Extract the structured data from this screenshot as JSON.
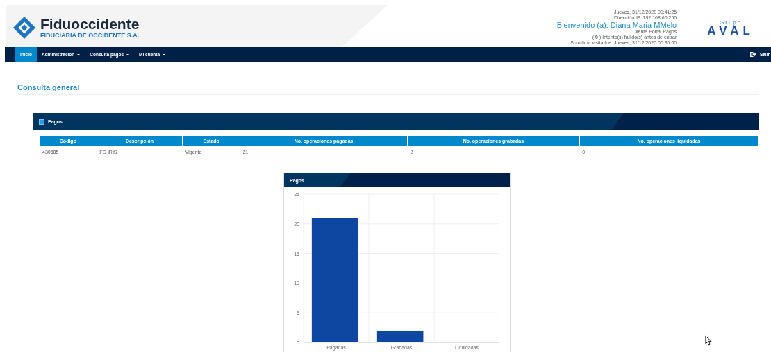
{
  "header": {
    "brand": "Fiduoccidente",
    "brand_subtitle": "FIDUCIARIA DE OCCIDENTE S.A.",
    "date": "Jueves, 31/12/2020 00:41:25",
    "ip": "Dirección IP: 192.168.60.250",
    "welcome": "Bienvenido (a): Diana Maria MMelo",
    "role": "Cliente Portal Pagos",
    "failed_attempts": "( **0** ) Intento(s) fallido(s) antes de entrar",
    "last_visit": "Su última visita fue: Jueves, 31/12/2020 00:36:00",
    "partner_label": "Grupo",
    "partner_logo": "AVAL"
  },
  "nav": {
    "items": [
      {
        "label": "Inicio",
        "selected": true,
        "dropdown": false
      },
      {
        "label": "Administración",
        "selected": false,
        "dropdown": true
      },
      {
        "label": "Consulta pagos",
        "selected": false,
        "dropdown": true
      },
      {
        "label": "Mi cuenta",
        "selected": false,
        "dropdown": true
      }
    ],
    "logout": "Salir"
  },
  "page_title": "Consulta general",
  "panel": {
    "title": "Pagos",
    "table": {
      "columns": [
        "Código",
        "Descripción",
        "Estado",
        "No. operaciones pagadas",
        "No. operaciones grabadas",
        "No. operaciones liquidadas"
      ],
      "rows": [
        [
          "430685",
          "FG IRIS",
          "Vigente",
          "21",
          "2",
          "0"
        ]
      ]
    }
  },
  "chart_panel": {
    "title": "Pagos",
    "chart_data": {
      "type": "bar",
      "categories": [
        "Pagadas",
        "Grabadas",
        "Liquidadas"
      ],
      "series": [
        {
          "color": "#0d47a1",
          "values": [
            21,
            2,
            0
          ]
        }
      ],
      "grid": true,
      "ylim": [
        0,
        25
      ],
      "yticks": [
        0,
        5,
        10,
        15,
        20,
        25
      ]
    }
  }
}
